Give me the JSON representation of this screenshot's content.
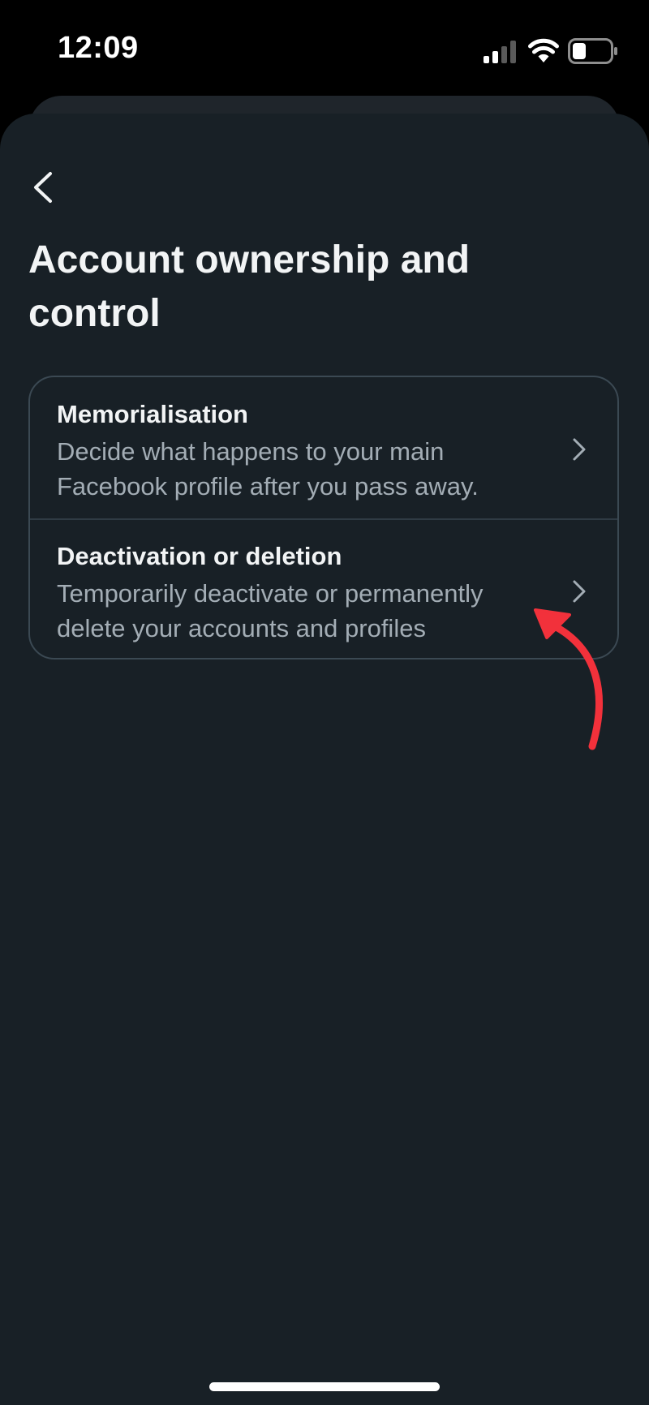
{
  "status_bar": {
    "time": "12:09"
  },
  "header": {
    "back_icon": "chevron-left-icon",
    "title": "Account ownership and control"
  },
  "menu": {
    "items": [
      {
        "title": "Memorialisation",
        "description": "Decide what happens to your main Facebook profile after you pass away.",
        "icon": "chevron-right-icon"
      },
      {
        "title": "Deactivation or deletion",
        "description": "Temporarily deactivate or permanently delete your accounts and profiles",
        "icon": "chevron-right-icon"
      }
    ]
  },
  "colors": {
    "background": "#182026",
    "card_border": "#3b4953",
    "title_text": "#f2f4f5",
    "description_text": "#a3adb5",
    "annotation_arrow": "#f2313b"
  }
}
